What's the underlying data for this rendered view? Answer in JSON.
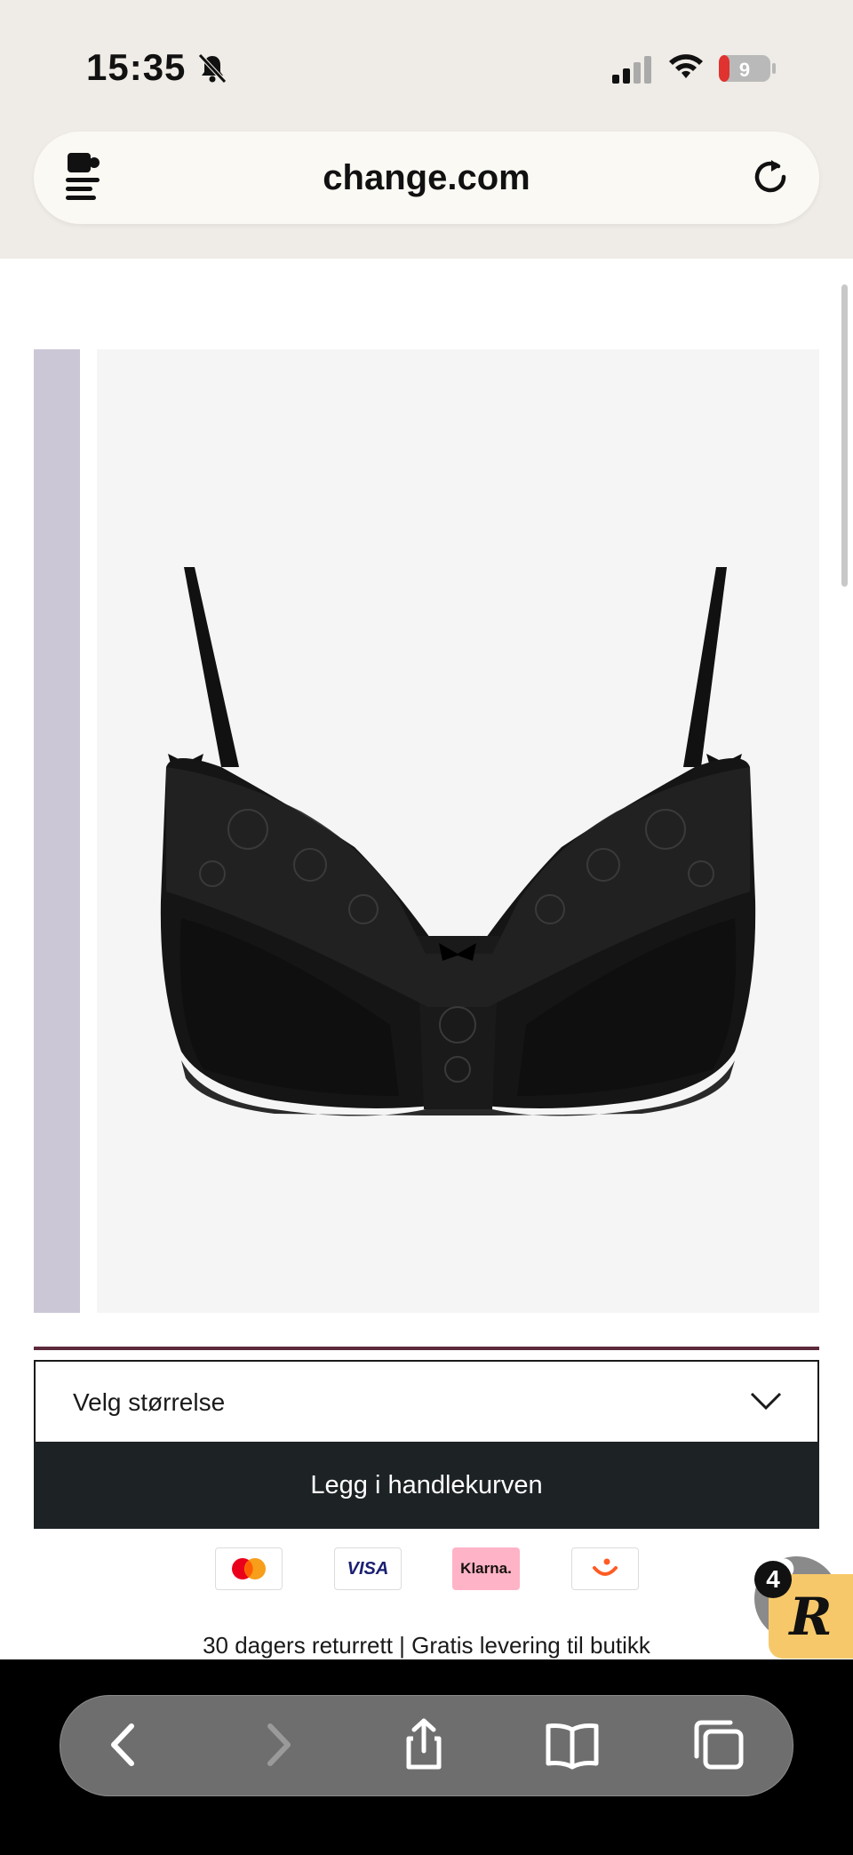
{
  "status_bar": {
    "time": "15:35",
    "battery": "9"
  },
  "browser": {
    "url": "change.com"
  },
  "product": {
    "wishlist_icon": "heart-icon"
  },
  "size_selector": {
    "label": "Velg størrelse"
  },
  "cart": {
    "add_label": "Legg i handlekurven"
  },
  "payments": [
    {
      "name": "Mastercard",
      "label": ""
    },
    {
      "name": "Visa",
      "label": "VISA"
    },
    {
      "name": "Klarna",
      "label": "Klarna."
    },
    {
      "name": "Vipps",
      "label": ""
    }
  ],
  "shipping_info": "30 dagers returrett | Gratis levering til butikk",
  "reviews_widget": {
    "count": "4",
    "letter": "R"
  },
  "colors": {
    "accent": "#5c2a3a",
    "cart_button": "#1d2224",
    "reviews_bg": "#f7c86a",
    "klarna_pink": "#ffb3c7"
  }
}
